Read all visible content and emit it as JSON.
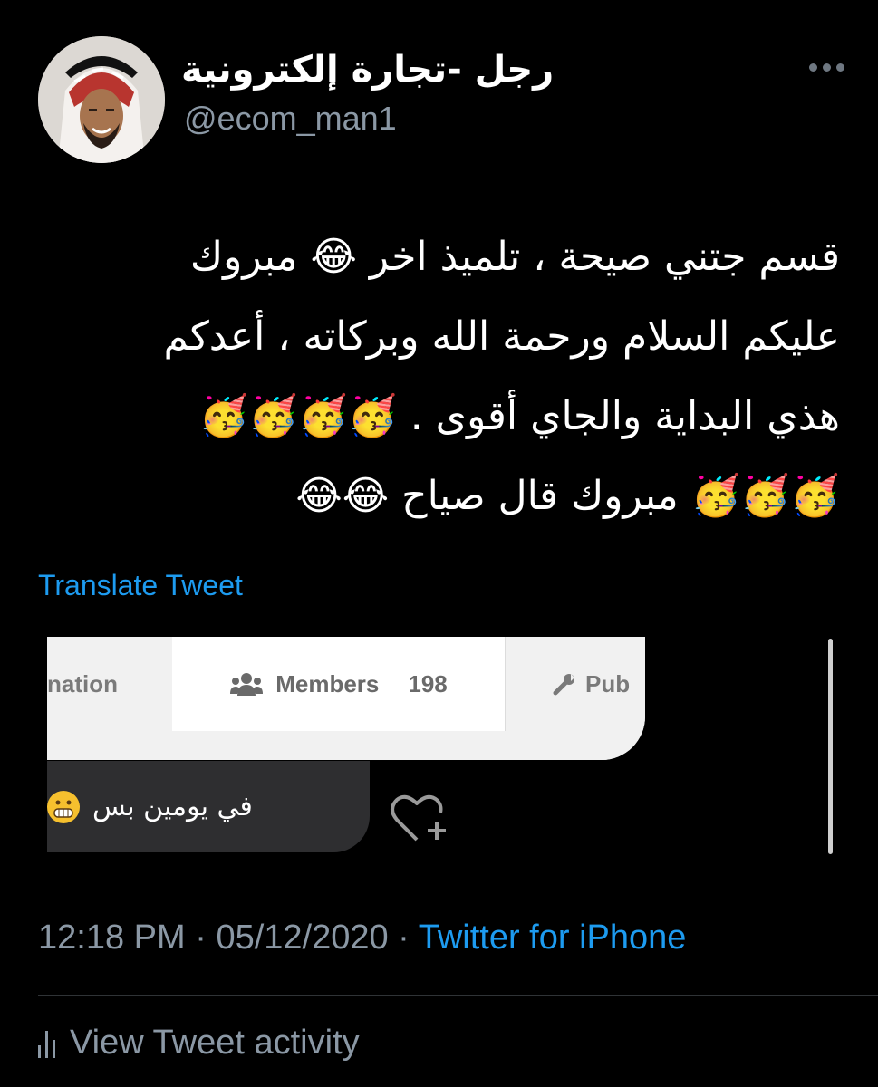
{
  "tweet": {
    "display_name": "رجل -تجارة إلكترونية",
    "handle": "@ecom_man1",
    "text_lines": [
      "قسم جتني صيحة ، تلميذ اخر 😂 مبروك",
      "عليكم السلام ورحمة الله وبركاته ، أعدكم",
      "هذي البداية والجاي أقوى . 🥳🥳🥳🥳",
      "🥳🥳🥳 مبروك قال صياح 😂😂"
    ],
    "translate_label": "Translate Tweet",
    "time": "12:18 PM",
    "separator": " · ",
    "date": "05/12/2020",
    "source": "Twitter for iPhone",
    "activity_label": "View Tweet activity"
  },
  "media": {
    "tab_info": "nation",
    "tab_members": "Members",
    "members_count": "198",
    "tab_pub": "Pub",
    "comment_text": "في يومين بس"
  },
  "icons": {
    "more": "more-dots-icon",
    "members": "users-group-icon",
    "wrench": "wrench-icon",
    "heart_plus": "heart-plus-icon",
    "activity": "bar-chart-icon",
    "grimace": "grimacing-face-icon"
  },
  "colors": {
    "background": "#000000",
    "link": "#1d9bf0",
    "secondary_text": "#8b98a5"
  }
}
